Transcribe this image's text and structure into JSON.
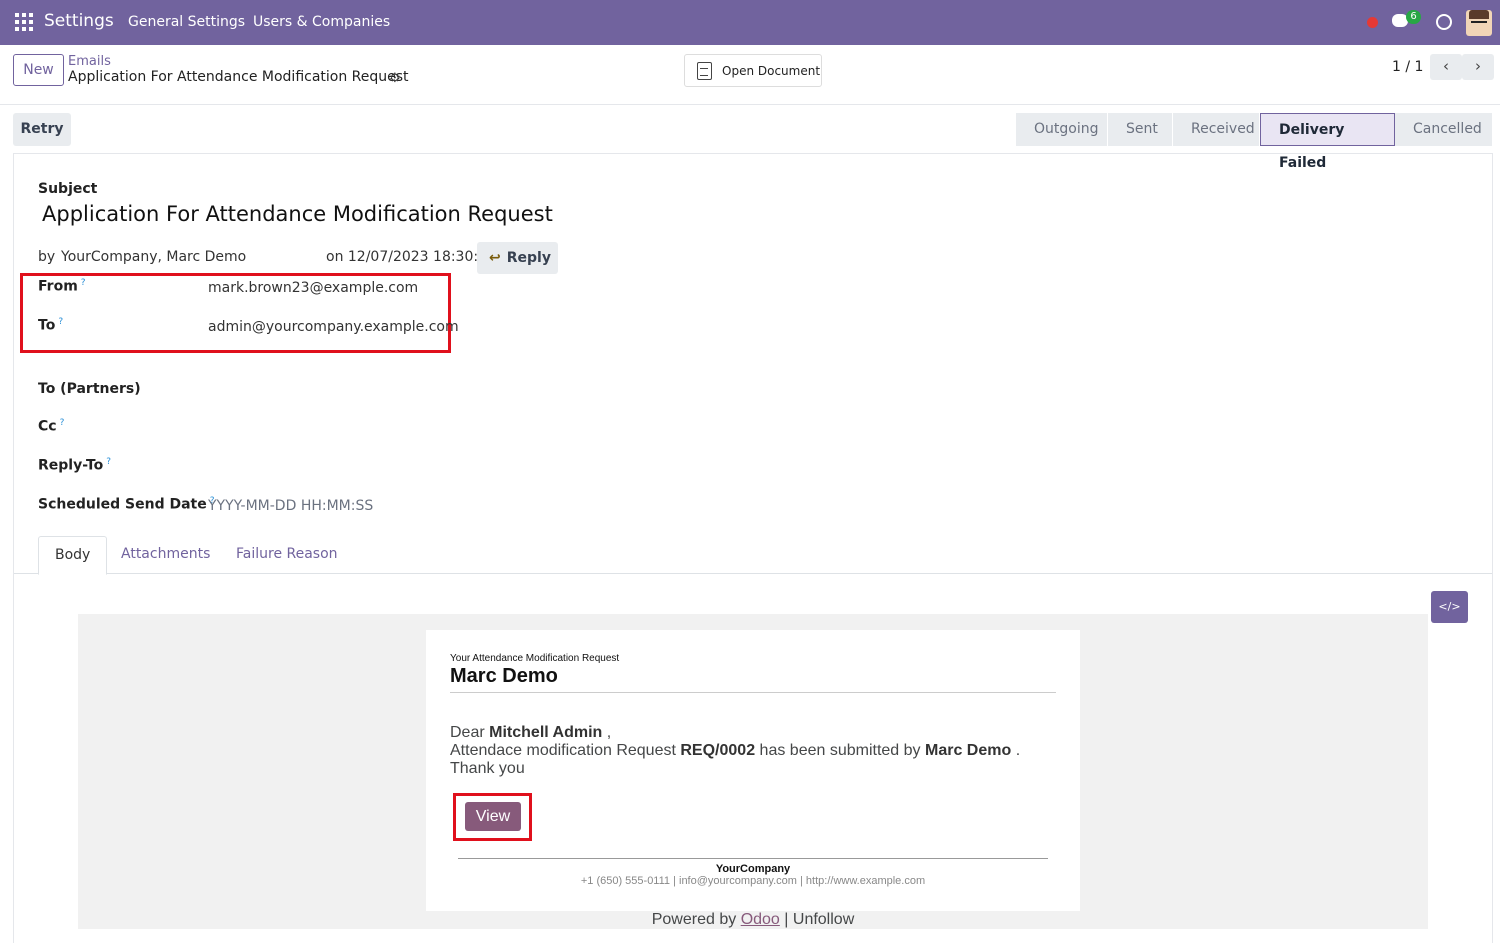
{
  "topbar": {
    "app_name": "Settings",
    "nav": [
      "General Settings",
      "Users & Companies"
    ],
    "chat_badge": "6"
  },
  "control_panel": {
    "new_label": "New",
    "breadcrumb_parent": "Emails",
    "breadcrumb_current": "Application For Attendance Modification Request",
    "open_document_label": "Open Document",
    "pager": "1 / 1"
  },
  "status": {
    "retry_label": "Retry",
    "stages": [
      "Outgoing",
      "Sent",
      "Received",
      "Delivery Failed",
      "Cancelled"
    ],
    "active_stage": "Delivery Failed"
  },
  "form": {
    "subject_label": "Subject",
    "subject": "Application For Attendance Modification Request",
    "by_prefix": "by",
    "authors": "YourCompany, Marc Demo",
    "date": "on 12/07/2023 18:30:13",
    "reply_label": "Reply",
    "from_label": "From",
    "from_value": "mark.brown23@example.com",
    "to_label": "To",
    "to_value": "admin@yourcompany.example.com",
    "to_partners_label": "To (Partners)",
    "cc_label": "Cc",
    "reply_to_label": "Reply-To",
    "scheduled_label": "Scheduled Send Date",
    "scheduled_placeholder": "YYYY-MM-DD HH:MM:SS",
    "help_mark": "?"
  },
  "tabs": [
    "Body",
    "Attachments",
    "Failure Reason"
  ],
  "code_button": "</>",
  "email_body": {
    "pre_title": "Your Attendance Modification Request",
    "name": "Marc Demo",
    "dear": "Dear",
    "recipient": "Mitchell Admin",
    "comma": ",",
    "request_text_1": "Attendace modification Request",
    "request_ref": "REQ/0002",
    "request_text_2": "has been submitted by",
    "submitter": "Marc Demo",
    "period": ".",
    "thanks": "Thank you",
    "view_label": "View",
    "company": "YourCompany",
    "contact": "+1 (650) 555-0111 | info@yourcompany.com | http://www.example.com",
    "powered_by": "Powered by",
    "odoo": "Odoo",
    "unfollow": "| Unfollow"
  },
  "colors": {
    "brand": "#71639e",
    "button": "#875a7b",
    "highlight": "#e0101c"
  }
}
